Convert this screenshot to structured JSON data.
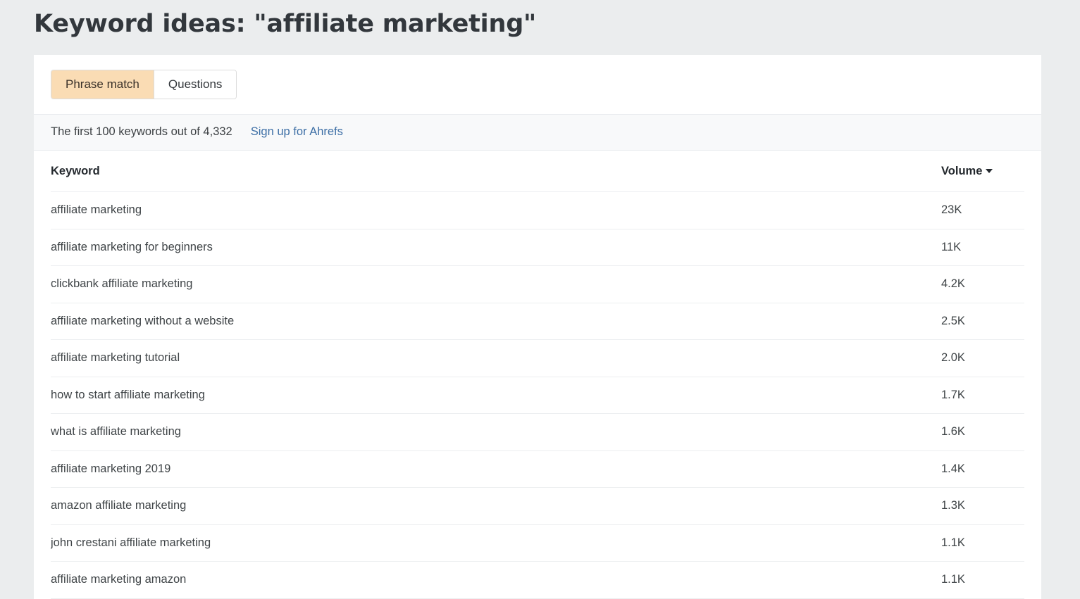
{
  "page": {
    "title": "Keyword ideas: \"affiliate marketing\""
  },
  "tabs": [
    {
      "label": "Phrase match",
      "active": true
    },
    {
      "label": "Questions",
      "active": false
    }
  ],
  "info_bar": {
    "text": "The first 100 keywords out of 4,332",
    "link_label": "Sign up for Ahrefs"
  },
  "table": {
    "columns": [
      {
        "key": "keyword",
        "label": "Keyword",
        "sorted": false
      },
      {
        "key": "volume",
        "label": "Volume",
        "sorted": true,
        "sort_direction": "desc",
        "sort_icon": "caret-down-icon"
      }
    ],
    "rows": [
      {
        "keyword": "affiliate marketing",
        "volume": "23K"
      },
      {
        "keyword": "affiliate marketing for beginners",
        "volume": "11K"
      },
      {
        "keyword": "clickbank affiliate marketing",
        "volume": "4.2K"
      },
      {
        "keyword": "affiliate marketing without a website",
        "volume": "2.5K"
      },
      {
        "keyword": "affiliate marketing tutorial",
        "volume": "2.0K"
      },
      {
        "keyword": "how to start affiliate marketing",
        "volume": "1.7K"
      },
      {
        "keyword": "what is affiliate marketing",
        "volume": "1.6K"
      },
      {
        "keyword": "affiliate marketing 2019",
        "volume": "1.4K"
      },
      {
        "keyword": "amazon affiliate marketing",
        "volume": "1.3K"
      },
      {
        "keyword": "john crestani affiliate marketing",
        "volume": "1.1K"
      },
      {
        "keyword": "affiliate marketing amazon",
        "volume": "1.1K"
      }
    ]
  },
  "colors": {
    "page_background": "#ebedee",
    "card_background": "#ffffff",
    "active_tab_background": "#fadcb4",
    "link": "#3c6ea5",
    "info_bar_background": "#f8f9fa",
    "divider": "#eceef0",
    "text": "#3f4447",
    "heading": "#32373c"
  }
}
